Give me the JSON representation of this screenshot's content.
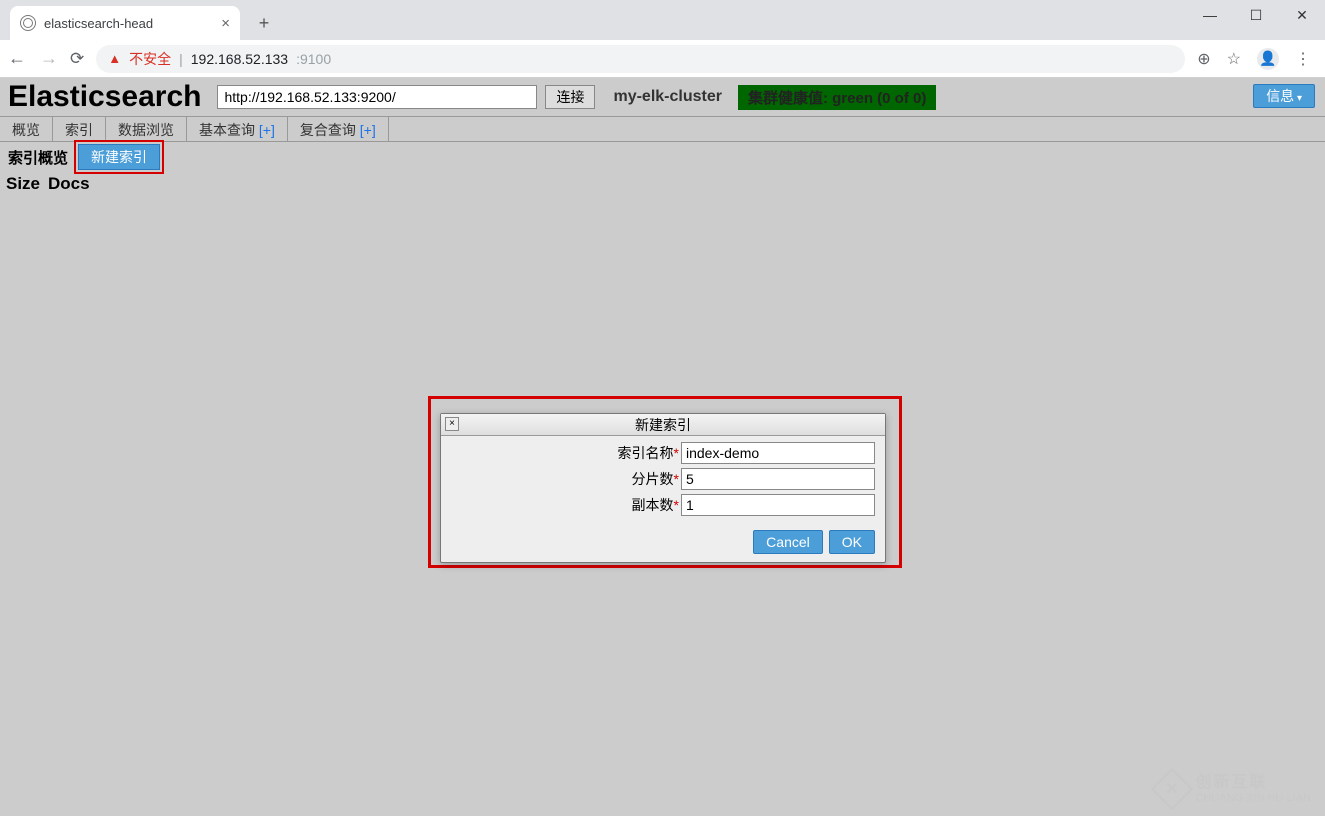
{
  "browser": {
    "tab_title": "elasticsearch-head",
    "url_host": "192.168.52.133",
    "url_port": ":9100",
    "insecure_label": "不安全"
  },
  "app": {
    "logo": "Elasticsearch",
    "connect_url": "http://192.168.52.133:9200/",
    "connect_label": "连接",
    "cluster_name": "my-elk-cluster",
    "health_text": "集群健康值: green (0 of 0)",
    "info_label": "信息"
  },
  "tabs": {
    "overview": "概览",
    "index": "索引",
    "browse": "数据浏览",
    "basic_query": "基本查询",
    "compound_query": "复合查询",
    "plus": "[+]"
  },
  "toolbar": {
    "index_overview": "索引概览",
    "create_index": "新建索引"
  },
  "table": {
    "col_size": "Size",
    "col_docs": "Docs"
  },
  "dialog": {
    "title": "新建索引",
    "name_label": "索引名称",
    "shards_label": "分片数",
    "replicas_label": "副本数",
    "name_value": "index-demo",
    "shards_value": "5",
    "replicas_value": "1",
    "cancel": "Cancel",
    "ok": "OK"
  },
  "watermark": {
    "big": "创新互联",
    "small": "CHUANG XIN HU LIAN"
  }
}
